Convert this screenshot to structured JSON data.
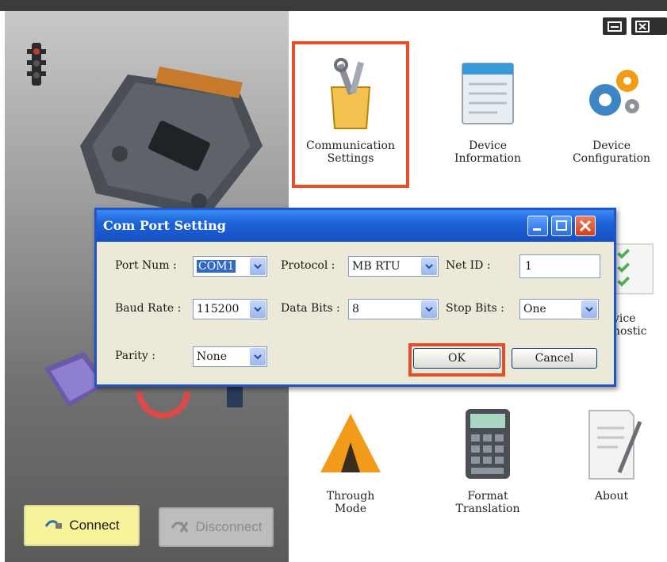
{
  "window": {
    "controls": [
      {
        "icon": "minimize-icon"
      },
      {
        "icon": "close-icon"
      }
    ]
  },
  "left_pane": {
    "status_icon": "traffic-light-icon",
    "connect_label": "Connect",
    "connect_icon": "connect-plug-icon",
    "disconnect_label": "Disconnect",
    "disconnect_icon": "disconnect-plug-icon"
  },
  "tiles": [
    {
      "label_line1": "Communication",
      "label_line2": "Settings",
      "icon": "tools-icon",
      "highlighted": true
    },
    {
      "label_line1": "Device",
      "label_line2": "Information",
      "icon": "info-panel-icon"
    },
    {
      "label_line1": "Device",
      "label_line2": "Configuration",
      "icon": "gears-icon"
    },
    {
      "label_line1": "vice",
      "label_line2": "nostic",
      "icon": "checklist-icon"
    },
    {
      "label_line1": "Through",
      "label_line2": "Mode",
      "icon": "cone-icon"
    },
    {
      "label_line1": "Format",
      "label_line2": "Translation",
      "icon": "calculator-icon"
    },
    {
      "label_line1": "About",
      "label_line2": "",
      "icon": "document-icon"
    }
  ],
  "dialog": {
    "title": "Com Port Setting",
    "port_num": {
      "label": "Port Num :",
      "value": "COM1"
    },
    "protocol": {
      "label": "Protocol :",
      "value": "MB RTU"
    },
    "net_id": {
      "label": "Net ID :",
      "value": "1"
    },
    "baud_rate": {
      "label": "Baud Rate :",
      "value": "115200"
    },
    "data_bits": {
      "label": "Data Bits :",
      "value": "8"
    },
    "stop_bits": {
      "label": "Stop Bits :",
      "value": "One"
    },
    "parity": {
      "label": "Parity :",
      "value": "None"
    },
    "ok_label": "OK",
    "cancel_label": "Cancel"
  },
  "colors": {
    "highlight": "#e44d26",
    "title_bar": "#1c63d8",
    "dialog_bg": "#ece9d8",
    "connect_bg": "#f6f39a"
  }
}
